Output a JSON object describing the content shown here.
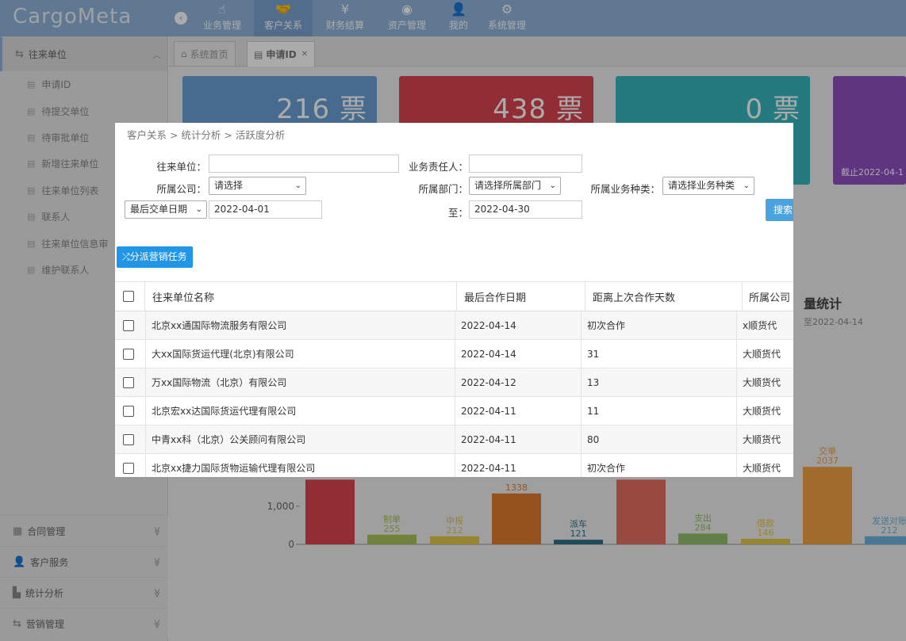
{
  "app": {
    "logo": "CargoMeta"
  },
  "topnav": [
    {
      "label": "业务管理",
      "icon": "☝",
      "active": false
    },
    {
      "label": "客户关系",
      "icon": "🤝",
      "active": true
    },
    {
      "label": "财务结算",
      "icon": "¥",
      "active": false
    },
    {
      "label": "资产管理",
      "icon": "◉",
      "active": false
    },
    {
      "label": "我的",
      "icon": "👤",
      "active": false
    },
    {
      "label": "系统管理",
      "icon": "⚙",
      "active": false
    }
  ],
  "sidebar": {
    "open_section": "往来单位",
    "items": [
      "申请ID",
      "待提交单位",
      "待审批单位",
      "新增往来单位",
      "往来单位列表",
      "联系人",
      "往来单位信息审",
      "维护联系人"
    ],
    "sections": [
      "合同管理",
      "客户服务",
      "统计分析",
      "营销管理"
    ]
  },
  "tabs": [
    {
      "label": "系统首页"
    },
    {
      "label": "申请ID"
    }
  ],
  "cards": [
    {
      "value": "216 票",
      "color": "#6aa0d6"
    },
    {
      "value": "438 票",
      "color": "#d9444f"
    },
    {
      "value": "0 票",
      "color": "#36b6bd"
    },
    {
      "value": "",
      "color": "#8e4fbf",
      "footer": "截止2022-04-1"
    }
  ],
  "background_chart": {
    "title": "量统计",
    "subtitle": "至2022-04-14",
    "ytick_1000": "1,000",
    "ytick_0": "0",
    "bars": [
      {
        "label": "",
        "value": 1700,
        "color": "#d9444f"
      },
      {
        "label": "制单",
        "value": 255,
        "color": "#a8c25a"
      },
      {
        "label": "申报",
        "value": 212,
        "color": "#e3c64a"
      },
      {
        "label": "",
        "value": 1338,
        "color": "#e07b2e"
      },
      {
        "label": "派车",
        "value": 121,
        "color": "#2e6f88"
      },
      {
        "label": "",
        "value": 1700,
        "color": "#e36f60"
      },
      {
        "label": "支出",
        "value": 284,
        "color": "#8fbf6a"
      },
      {
        "label": "借款",
        "value": 146,
        "color": "#e3c64a"
      },
      {
        "label": "交单",
        "value": 2037,
        "color": "#f0a040"
      },
      {
        "label": "发送对账",
        "value": 212,
        "color": "#6ab4e0"
      }
    ]
  },
  "dialog": {
    "breadcrumb": "客户关系 > 统计分析 > 活跃度分析",
    "form": {
      "company_label": "往来单位：",
      "owner_label": "业务责任人：",
      "corp_label": "所属公司：",
      "corp_value": "请选择",
      "dept_label": "所属部门：",
      "dept_value": "请选择所属部门",
      "biz_label": "所属业务种类：",
      "biz_value": "请选择业务种类",
      "date_type": "最后交单日期",
      "date_from": "2022-04-01",
      "to_label": "至：",
      "date_to": "2022-04-30",
      "search": "搜索"
    },
    "assign_button": "分派营销任务",
    "columns": [
      "往来单位名称",
      "最后合作日期",
      "距离上次合作天数",
      "所属公司"
    ],
    "rows": [
      {
        "name": "北京xx通国际物流服务有限公司",
        "date": "2022-04-14",
        "days": "初次合作",
        "corp": "x顺货代"
      },
      {
        "name": "大xx国际货运代理(北京)有限公司",
        "date": "2022-04-14",
        "days": "31",
        "corp": "大顺货代"
      },
      {
        "name": "万xx国际物流（北京）有限公司",
        "date": "2022-04-12",
        "days": "13",
        "corp": "大顺货代"
      },
      {
        "name": "北京宏xx达国际货运代理有限公司",
        "date": "2022-04-11",
        "days": "11",
        "corp": "大顺货代"
      },
      {
        "name": "中青xx科（北京）公关顾问有限公司",
        "date": "2022-04-11",
        "days": "80",
        "corp": "大顺货代"
      },
      {
        "name": "北京xx捷力国际货物运输代理有限公司",
        "date": "2022-04-11",
        "days": "初次合作",
        "corp": "大顺货代"
      }
    ]
  }
}
